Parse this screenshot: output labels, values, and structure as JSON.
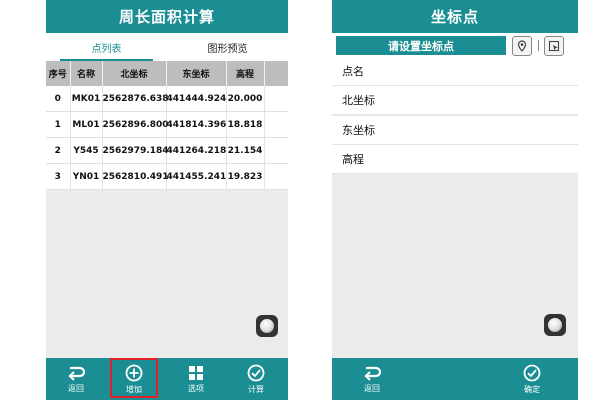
{
  "left": {
    "title": "周长面积计算",
    "tabs": [
      "点列表",
      "图形预览"
    ],
    "table": {
      "headers": [
        "序号",
        "名称",
        "北坐标",
        "东坐标",
        "高程"
      ],
      "rows": [
        [
          "0",
          "MK01",
          "2562876.638",
          "441444.924",
          "20.000"
        ],
        [
          "1",
          "ML01",
          "2562896.800",
          "441814.396",
          "18.818"
        ],
        [
          "2",
          "Y545",
          "2562979.184",
          "441264.218",
          "21.154"
        ],
        [
          "3",
          "YN01",
          "2562810.491",
          "441455.241",
          "19.823"
        ]
      ]
    },
    "nav": [
      "返回",
      "增加",
      "选项",
      "计算"
    ]
  },
  "right": {
    "title": "坐标点",
    "set_point_label": "请设置坐标点",
    "fields": [
      "点名",
      "北坐标",
      "东坐标",
      "高程"
    ],
    "nav": [
      "返回",
      "确定"
    ]
  },
  "colors": {
    "primary": "#1a8e92",
    "highlight": "#e0232a"
  }
}
